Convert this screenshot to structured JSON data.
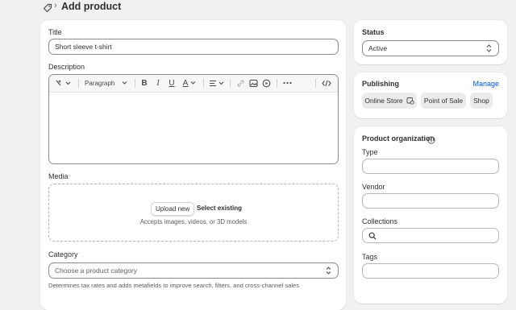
{
  "breadcrumb": {
    "icon": "tag-icon",
    "separator": "›",
    "title": "Add product"
  },
  "product": {
    "title_label": "Title",
    "title_value": "Short sleeve t-shirt",
    "description_label": "Description",
    "toolbar": {
      "format": "Paragraph"
    },
    "media_label": "Media",
    "upload_new": "Upload new",
    "select_existing": "Select existing",
    "media_hint": "Accepts images, videos, or 3D models",
    "category_label": "Category",
    "category_placeholder": "Choose a product category",
    "category_help": "Determines tax rates and adds metafields to improve search, filters, and cross-channel sales"
  },
  "status": {
    "label": "Status",
    "value": "Active"
  },
  "publishing": {
    "label": "Publishing",
    "manage": "Manage",
    "channels": [
      "Online Store",
      "Point of Sale",
      "Shop"
    ]
  },
  "organization": {
    "label": "Product organization",
    "type_label": "Type",
    "vendor_label": "Vendor",
    "collections_label": "Collections",
    "tags_label": "Tags"
  },
  "colors": {
    "accent": "#005bd3",
    "background": "#f1f1f1",
    "card": "#ffffff"
  }
}
